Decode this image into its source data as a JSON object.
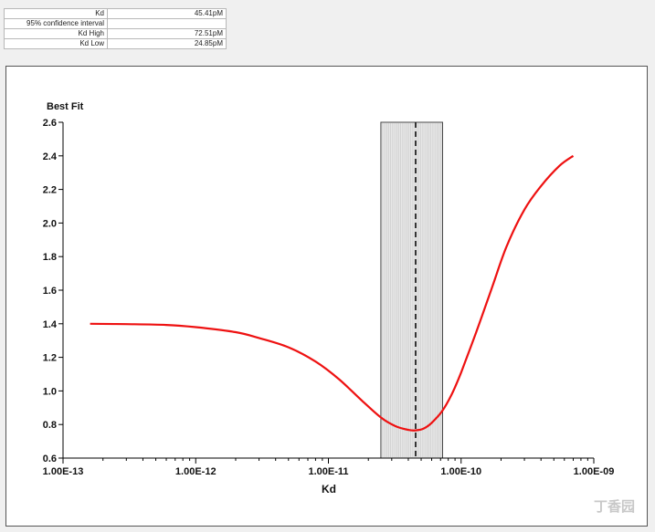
{
  "results_table": {
    "rows": [
      {
        "label": "Kd",
        "value": "45.41pM"
      },
      {
        "label": "95% confidence interval",
        "value": ""
      },
      {
        "label": "Kd High",
        "value": "72.51pM"
      },
      {
        "label": "Kd Low",
        "value": "24.85pM"
      }
    ]
  },
  "watermark": {
    "text": "丁香园"
  },
  "chart_data": {
    "type": "line",
    "title": "",
    "xlabel": "Kd",
    "ylabel": "Best Fit",
    "x_scale": "log",
    "xlim": [
      1e-13,
      1e-09
    ],
    "ylim": [
      0.6,
      2.6
    ],
    "x_ticks": [
      1e-13,
      1e-12,
      1e-11,
      1e-10,
      1e-09
    ],
    "x_tick_labels": [
      "1.00E-13",
      "1.00E-12",
      "1.00E-11",
      "1.00E-10",
      "1.00E-09"
    ],
    "y_ticks": [
      0.6,
      0.8,
      1.0,
      1.2,
      1.4,
      1.6,
      1.8,
      2.0,
      2.2,
      2.4,
      2.6
    ],
    "y_tick_labels": [
      "0.6",
      "0.8",
      "1.0",
      "1.2",
      "1.4",
      "1.6",
      "1.8",
      "2.0",
      "2.2",
      "2.4",
      "2.6"
    ],
    "grid": false,
    "colors": {
      "curve": "#ee1111",
      "band_fill": "#e8e8e8",
      "band_stroke": "#444444",
      "best_fit_line": "#111111"
    },
    "confidence_band": {
      "low": 2.485e-11,
      "high": 7.251e-11
    },
    "best_fit_kd": 4.541e-11,
    "series": [
      {
        "x": [
          1.6e-13,
          3e-13,
          6e-13,
          1e-12,
          2e-12,
          3e-12,
          5e-12,
          8e-12,
          1.2e-11,
          1.8e-11,
          2.5e-11,
          3.2e-11,
          4e-11,
          4.541e-11,
          5.2e-11,
          6e-11,
          7.2e-11,
          8.5e-11,
          1e-10,
          1.3e-10,
          1.7e-10,
          2.2e-10,
          3e-10,
          4e-10,
          5.5e-10,
          7e-10
        ],
        "y": [
          1.4,
          1.398,
          1.393,
          1.38,
          1.35,
          1.315,
          1.26,
          1.175,
          1.07,
          0.94,
          0.84,
          0.79,
          0.768,
          0.765,
          0.775,
          0.81,
          0.88,
          0.98,
          1.11,
          1.35,
          1.61,
          1.86,
          2.08,
          2.22,
          2.34,
          2.4
        ]
      }
    ]
  }
}
